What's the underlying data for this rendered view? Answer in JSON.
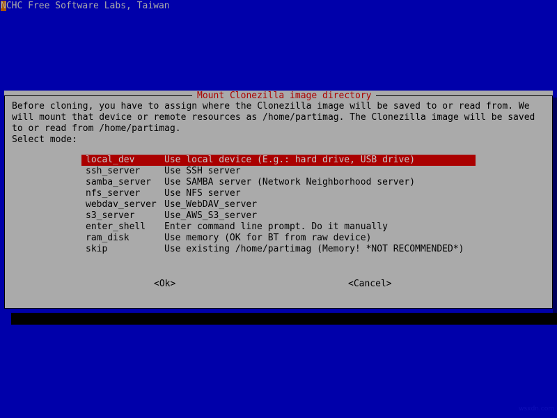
{
  "screen": {
    "background_color": "#0000aa",
    "header_text": "NCHC Free Software Labs, Taiwan",
    "header_cursor_char": "N",
    "header_cursor_color": "#aa5500",
    "header_text_color": "#aaaaaa",
    "watermark": "wsxdn.com"
  },
  "dialog": {
    "title": "Mount Clonezilla image directory",
    "title_color": "#aa0000",
    "background_color": "#aaaaaa",
    "border_color": "#000000",
    "body_lines": [
      "Before cloning, you have to assign where the Clonezilla image will be saved to or read from. We",
      "will mount that device or remote resources as /home/partimag. The Clonezilla image will be saved",
      "to or read from /home/partimag.",
      "Select mode:"
    ],
    "selection_background": "#aa0000",
    "selection_foreground": "#c8c8c8",
    "menu": [
      {
        "key": "local_dev",
        "description": "Use local device (E.g.: hard drive, USB drive)",
        "selected": true
      },
      {
        "key": "ssh_server",
        "description": "Use SSH server",
        "selected": false
      },
      {
        "key": "samba_server",
        "description": "Use SAMBA server (Network Neighborhood server)",
        "selected": false
      },
      {
        "key": "nfs_server",
        "description": "Use NFS server",
        "selected": false
      },
      {
        "key": "webdav_server",
        "description": "Use_WebDAV_server",
        "selected": false
      },
      {
        "key": "s3_server",
        "description": "Use_AWS_S3_server",
        "selected": false
      },
      {
        "key": "enter_shell",
        "description": "Enter command line prompt. Do it manually",
        "selected": false
      },
      {
        "key": "ram_disk",
        "description": "Use memory (OK for BT from raw device)",
        "selected": false
      },
      {
        "key": "skip",
        "description": "Use existing /home/partimag (Memory! *NOT RECOMMENDED*)",
        "selected": false
      }
    ],
    "buttons": {
      "ok": "<Ok>",
      "cancel": "<Cancel>"
    }
  }
}
